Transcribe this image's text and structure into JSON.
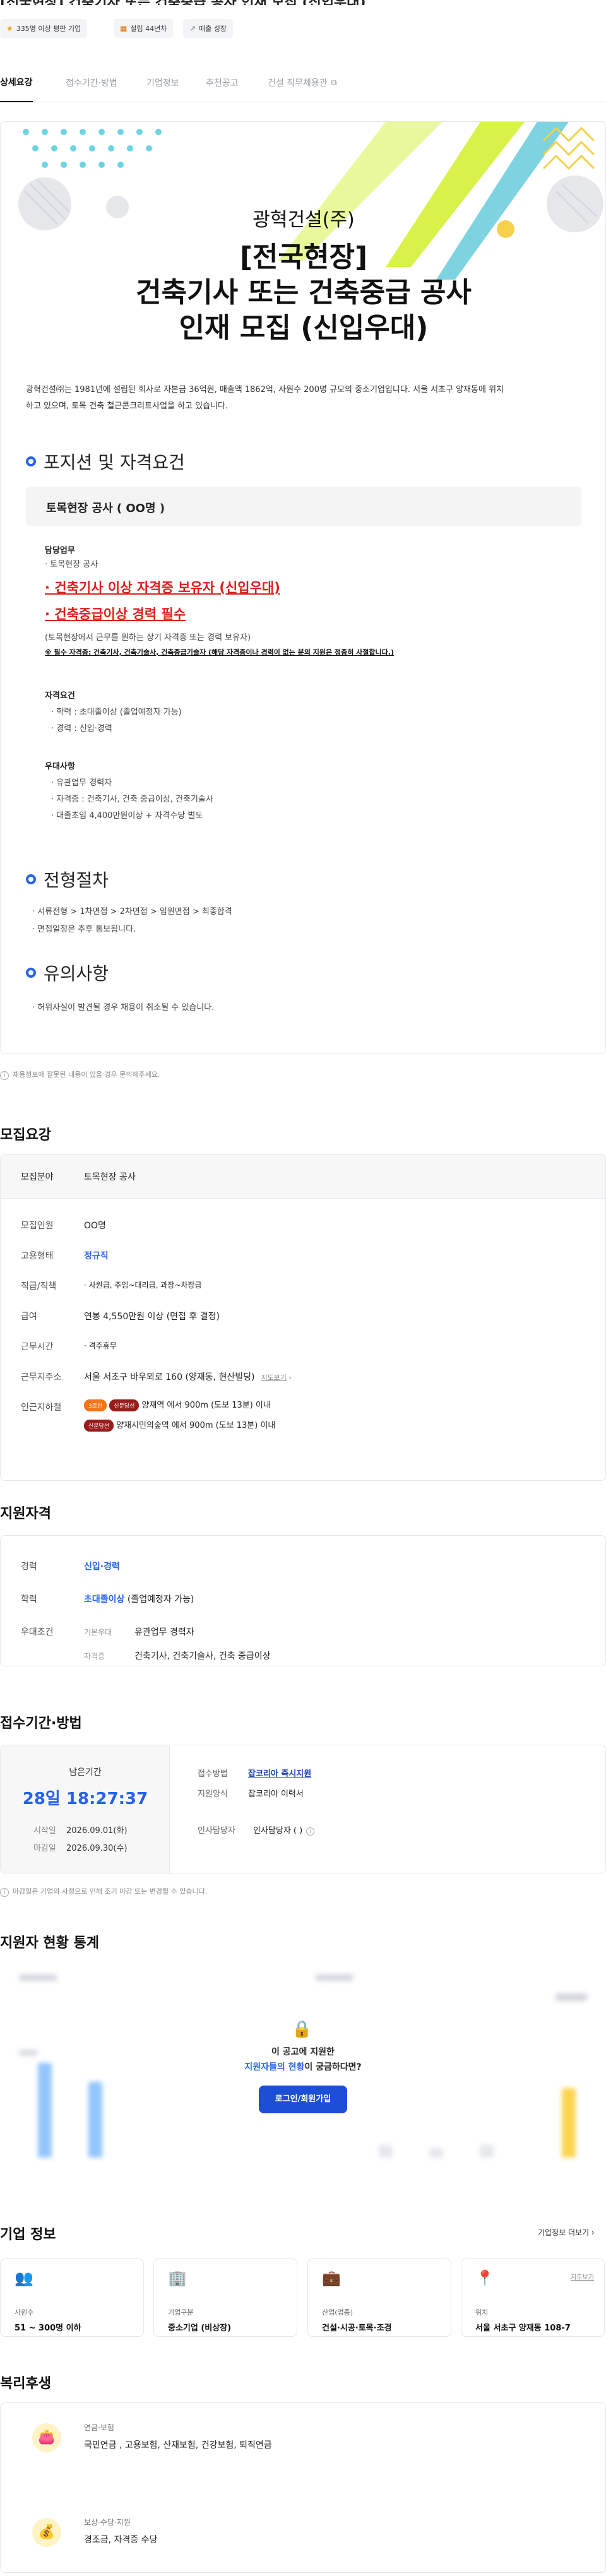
{
  "header": {
    "title": "[전국현장] 건축기사 또는 건축중급 공사 인재 모집 (신입우대)",
    "chips": [
      {
        "icon": "star-icon",
        "label": "335명 이상 평판 기업"
      },
      {
        "icon": "building-icon",
        "label": "설립 44년차"
      },
      {
        "icon": "trend-icon",
        "label": "매출 성장"
      }
    ]
  },
  "tabs": [
    "상세요강",
    "접수기간·방법",
    "기업정보",
    "추천공고",
    "건설 직무체용관"
  ],
  "posting": {
    "company": "광혁건설(주)",
    "title_line1": "[전국현장]",
    "title_line2": "건축기사 또는 건축중급 공사",
    "title_line3": "인재 모집 (신입우대)",
    "intro_1": "광혁건설㈜는 1981년에 설립된 회사로 자본금 36억원, 매출액 1862억, 사원수 200명 규모의 중소기업입니다. 서울 서초구 양재동에 위치",
    "intro_2": "하고 있으며, 토목 건축 철근콘크리트사업을 하고 있습니다.",
    "sec1_title": "포지션 및 자격요건",
    "position_name": "토목현장 공사 ( OO명 )",
    "duty_head": "담당업무",
    "duty_item": "· 토목현장 공사",
    "red_1": "· 건축기사 이상 자격증 보유자 (신입우대)",
    "red_2": "· 건축중급이상 경력 필수",
    "note_1": "(토목현장에서 근무를 원하는 상기 자격증 또는 경력 보유자)",
    "note_2": "※ 필수 자격증: 건축기사, 건축기술사, 건축중급기술자 (해당 자격증이나 경력이 없는 분의 지원은 정중히 사절합니다.)",
    "qual_head": "자격요건",
    "qual_1": "· 학력 : 초대졸이상 (졸업예정자 가능)",
    "qual_2": "· 경력 : 신입·경력",
    "pref_head": "우대사항",
    "pref_1": "· 유관업무 경력자",
    "pref_2": "· 자격증 : 건축기사, 건축 중급이상, 건축기술사",
    "pref_3": "· 대졸초임 4,400만원이상 + 자격수당 별도",
    "sec2_title": "전형절차",
    "proc_1": "· 서류전형 > 1차면접 > 2차면접 > 임원면접 > 최종합격",
    "proc_2": "· 면접일정은 추후 통보됩니다.",
    "sec3_title": "유의사항",
    "caution_1": "· 허위사실이 발견될 경우 채용이 취소될 수 있습니다.",
    "report_note": "채용정보에 잘못된 내용이 있을 경우 문의해주세요."
  },
  "recruit": {
    "title": "모집요강",
    "field_label": "모집분야",
    "field_value": "토목현장 공사",
    "rows": [
      {
        "label": "모집인원",
        "value": "OO명"
      },
      {
        "label": "고용형태",
        "value": "정규직"
      },
      {
        "label": "직급/직책",
        "value": "· 사원급, 주임~대리급, 과장~차장급"
      },
      {
        "label": "급여",
        "value": "연봉 4,550만원 이상 (면접 후 결정)"
      },
      {
        "label": "근무시간",
        "value": "· 격주휴무"
      },
      {
        "label": "근무지주소",
        "value": "서울 서초구 바우뫼로 160 (양재동, 현산빌딩)",
        "extra": "지도보기"
      }
    ],
    "subway_label": "인근지하철",
    "subway_1_badge1": "3호선",
    "subway_1_badge2": "신분당선",
    "subway_1_text": "양재역 에서 900m (도보 13분) 이내",
    "subway_2_badge": "신분당선",
    "subway_2_text": "양재시민의숲역 에서 900m (도보 13분) 이내"
  },
  "qualification": {
    "title": "지원자격",
    "career_label": "경력",
    "career_value": "신입·경력",
    "edu_label": "학력",
    "edu_value": "초대졸이상",
    "edu_suffix": "(졸업예정자 가능)",
    "pref_label": "우대조건",
    "pref_basic_label": "기본우대",
    "pref_basic_value": "유관업무 경력자",
    "pref_cert_label": "자격증",
    "pref_cert_value": "건축기사, 건축기술사, 건축 중급이상"
  },
  "apply": {
    "title": "접수기간·방법",
    "remaining_label": "남은기간",
    "remaining_value": "28일 18:27:37",
    "start_label": "시작일",
    "start_value": "2026.09.01(화)",
    "end_label": "마감일",
    "end_value": "2026.09.30(수)",
    "method_label": "접수방법",
    "method_value": "잡코리아 즉시지원",
    "form_label": "지원양식",
    "form_value": "잡코리아 이력서",
    "manager_label": "인사담당자",
    "manager_value": "인사담당자 ( )",
    "deadline_note": "마감일은 기업의 사정으로 인해 조기 마감 또는 변경될 수 있습니다."
  },
  "stats": {
    "title": "지원자 현황 통계",
    "overlay_line1": "이 공고에 지원한",
    "overlay_line2_a": "지원자들의 현황",
    "overlay_line2_b": "이 궁금하다면?",
    "login_button": "로그인/회원가입"
  },
  "corp": {
    "title": "기업 정보",
    "more": "기업정보 더보기",
    "map_link": "지도보기",
    "cards": [
      {
        "icon": "people-icon",
        "label": "사원수",
        "value": "51 ~ 300명 이하"
      },
      {
        "icon": "office-icon",
        "label": "기업구분",
        "value": "중소기업 (비상장)"
      },
      {
        "icon": "briefcase-icon",
        "label": "산업(업종)",
        "value": "건설·시공·토목·조경"
      },
      {
        "icon": "location-icon",
        "label": "위치",
        "value": "서울 서초구 양재동 108-7"
      }
    ]
  },
  "welfare": {
    "title": "복리후생",
    "items": [
      {
        "icon": "wallet-icon",
        "label": "연금·보험",
        "value": "국민연금 , 고용보험, 산재보험, 건강보험, 퇴직연금"
      },
      {
        "icon": "money-bag-icon",
        "label": "보상·수당·지원",
        "value": "경조금, 자격증 수당"
      }
    ]
  },
  "colors": {
    "accent": "#2563eb",
    "alert": "#e11d1d",
    "login": "#1d4ed8"
  }
}
